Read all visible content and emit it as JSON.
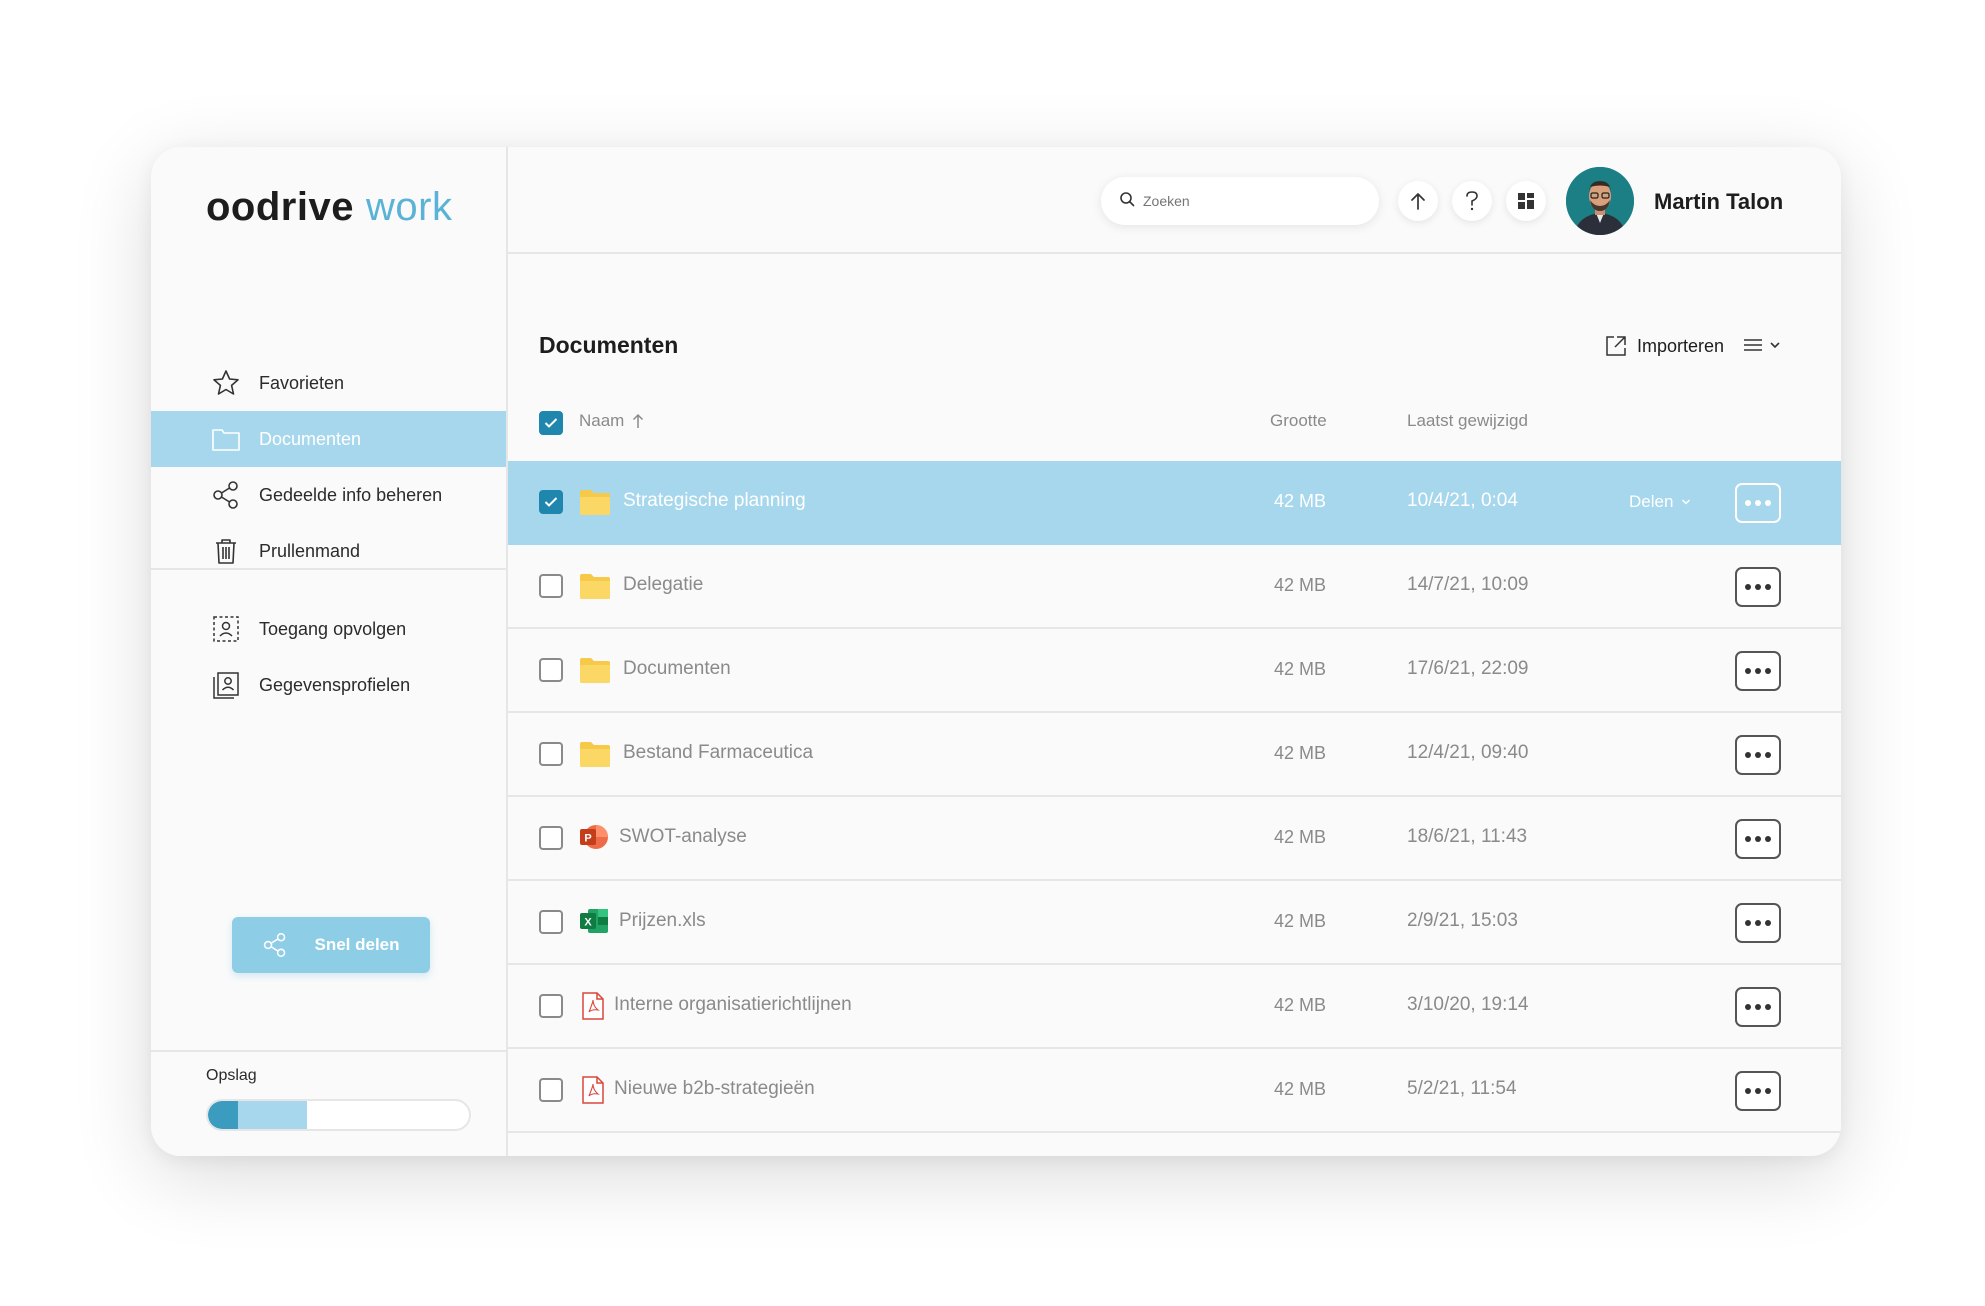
{
  "app": {
    "logo_brand": "oodrive",
    "logo_suffix": "work"
  },
  "colors": {
    "accent": "#a7d7ec",
    "primary": "#1f86ad",
    "brand_blue": "#5ab3d6"
  },
  "sidebar": {
    "items": [
      {
        "label": "Favorieten",
        "icon": "star-icon"
      },
      {
        "label": "Documenten",
        "icon": "folder-icon",
        "active": true
      },
      {
        "label": "Gedeelde info beheren",
        "icon": "share-icon"
      },
      {
        "label": "Prullenmand",
        "icon": "trash-icon"
      }
    ],
    "items2": [
      {
        "label": "Toegang opvolgen",
        "icon": "user-frame-icon"
      },
      {
        "label": "Gegevensprofielen",
        "icon": "profile-card-icon"
      }
    ],
    "quick_share_label": "Snel delen",
    "storage_label": "Opslag",
    "storage_used_fraction": 0.38
  },
  "header": {
    "search_placeholder": "Zoeken",
    "user_name": "Martin Talon"
  },
  "main": {
    "title": "Documenten",
    "import_label": "Importeren",
    "columns": {
      "name": "Naam",
      "size": "Grootte",
      "modified": "Laatst gewijzigd"
    },
    "share_label": "Delen",
    "rows": [
      {
        "name": "Strategische planning",
        "type": "folder",
        "size": "42 MB",
        "modified": "10/4/21, 0:04",
        "checked": true
      },
      {
        "name": "Delegatie",
        "type": "folder",
        "size": "42 MB",
        "modified": "14/7/21, 10:09",
        "checked": false
      },
      {
        "name": "Documenten",
        "type": "folder",
        "size": "42 MB",
        "modified": "17/6/21, 22:09",
        "checked": false
      },
      {
        "name": "Bestand Farmaceutica",
        "type": "folder",
        "size": "42 MB",
        "modified": "12/4/21, 09:40",
        "checked": false
      },
      {
        "name": "SWOT-analyse",
        "type": "powerpoint",
        "size": "42 MB",
        "modified": "18/6/21, 11:43",
        "checked": false
      },
      {
        "name": "Prijzen.xls",
        "type": "excel",
        "size": "42 MB",
        "modified": "2/9/21, 15:03",
        "checked": false
      },
      {
        "name": "Interne organisatierichtlijnen",
        "type": "pdf",
        "size": "42 MB",
        "modified": "3/10/20, 19:14",
        "checked": false
      },
      {
        "name": "Nieuwe b2b-strategieën",
        "type": "pdf",
        "size": "42 MB",
        "modified": "5/2/21, 11:54",
        "checked": false
      }
    ]
  }
}
